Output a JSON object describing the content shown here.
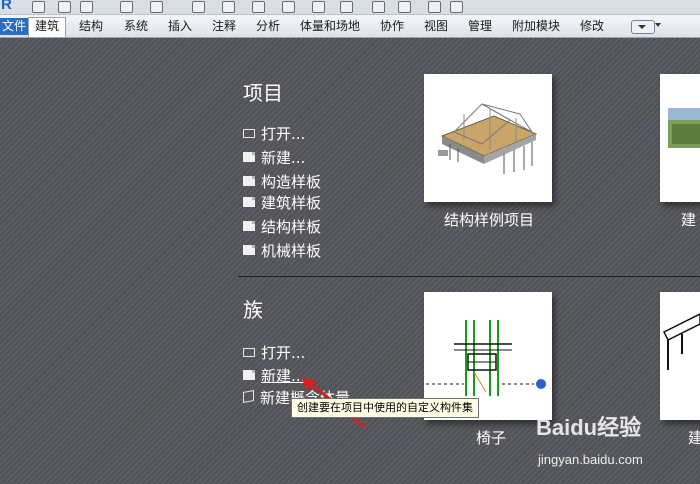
{
  "ribbon": {
    "tabs": [
      {
        "label": "文件"
      },
      {
        "label": "建筑"
      },
      {
        "label": "结构"
      },
      {
        "label": "系统"
      },
      {
        "label": "插入"
      },
      {
        "label": "注释"
      },
      {
        "label": "分析"
      },
      {
        "label": "体量和场地"
      },
      {
        "label": "协作"
      },
      {
        "label": "视图"
      },
      {
        "label": "管理"
      },
      {
        "label": "附加模块"
      },
      {
        "label": "修改"
      }
    ],
    "active_tab": "建筑"
  },
  "projects": {
    "heading": "项目",
    "links": [
      {
        "label": "打开...",
        "icon": "folder-icon"
      },
      {
        "label": "新建...",
        "icon": "document-icon"
      },
      {
        "label": "构造样板",
        "icon": "document-icon"
      },
      {
        "label": "建筑样板",
        "icon": "document-icon"
      },
      {
        "label": "结构样板",
        "icon": "document-icon"
      },
      {
        "label": "机械样板",
        "icon": "document-icon"
      }
    ],
    "thumbnails": [
      {
        "label": "结构样例项目"
      },
      {
        "label": "建"
      }
    ]
  },
  "families": {
    "heading": "族",
    "links": [
      {
        "label": "打开...",
        "icon": "folder-icon"
      },
      {
        "label": "新建...",
        "icon": "document-icon"
      },
      {
        "label": "新建概念体量",
        "icon": "cube-icon"
      }
    ],
    "thumbnails": [
      {
        "label": "椅子"
      },
      {
        "label": "建"
      }
    ]
  },
  "tooltip": {
    "text": "创建要在项目中使用的自定义构件集"
  },
  "watermark": {
    "logo": "Baidu经验",
    "url": "jingyan.baidu.com"
  },
  "colors": {
    "background": "#55575d",
    "file_tab": "#2b6cc4",
    "arrow": "#d42020"
  }
}
